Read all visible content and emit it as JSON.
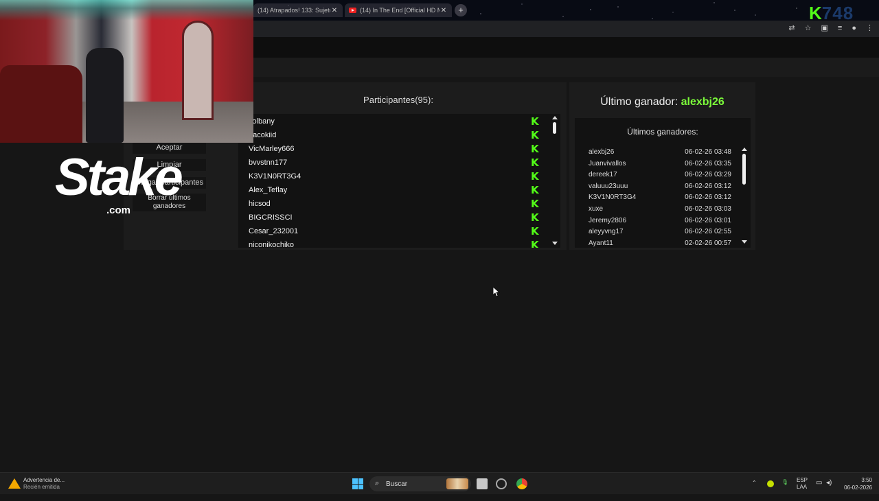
{
  "browser": {
    "tabs": [
      {
        "label": "(14) Atrapados! 133: Sujeto te..."
      },
      {
        "label": "(14) In The End [Official HD M..."
      }
    ],
    "tab_close": "✕",
    "new_tab": "+",
    "channel_logo": {
      "k": "K",
      "rest": "748"
    }
  },
  "controls": {
    "aceptar": "Aceptar",
    "limpiar": "Limpiar",
    "cargar": "Cargar participantes",
    "borrar": "Borrar últimos ganadores"
  },
  "participants": {
    "title": "Participantes(95):",
    "items": [
      {
        "name": "colbany"
      },
      {
        "name": "pacokiid"
      },
      {
        "name": "VicMarley666"
      },
      {
        "name": "bvvstnn177"
      },
      {
        "name": "K3V1N0RT3G4"
      },
      {
        "name": "Alex_Teflay"
      },
      {
        "name": "hicsod"
      },
      {
        "name": "BIGCRISSCI"
      },
      {
        "name": "Cesar_232001"
      },
      {
        "name": "niconikochiko"
      }
    ],
    "badge": "K"
  },
  "winner": {
    "label": "Último ganador: ",
    "name": "alexbj26",
    "list_title": "Últimos ganadores:",
    "items": [
      {
        "name": "alexbj26",
        "date": "06-02-26 03:48"
      },
      {
        "name": "Juanvivallos",
        "date": "06-02-26 03:35"
      },
      {
        "name": "dereek17",
        "date": "06-02-26 03:29"
      },
      {
        "name": "valuuu23uuu",
        "date": "06-02-26 03:12"
      },
      {
        "name": "K3V1N0RT3G4",
        "date": "06-02-26 03:12"
      },
      {
        "name": "xuxe",
        "date": "06-02-26 03:03"
      },
      {
        "name": "Jeremy2806",
        "date": "06-02-26 03:01"
      },
      {
        "name": "aleyyvng17",
        "date": "06-02-26 02:55"
      },
      {
        "name": "Ayant11",
        "date": "02-02-26 00:57"
      }
    ]
  },
  "overlay": {
    "brand": "Stake",
    "brand_suffix": ".com"
  },
  "taskbar": {
    "notification_title": "Advertencia de...",
    "notification_sub": "Recién emitida",
    "search_label": "Buscar",
    "lang_top": "ESP",
    "lang_bottom": "LAA",
    "time": "3:50",
    "date": "06-02-2026"
  },
  "colors": {
    "kick_green": "#53fc18",
    "winner_green": "#7cfc3a",
    "panel": "#1c1c1c",
    "list_bg": "#121212"
  }
}
